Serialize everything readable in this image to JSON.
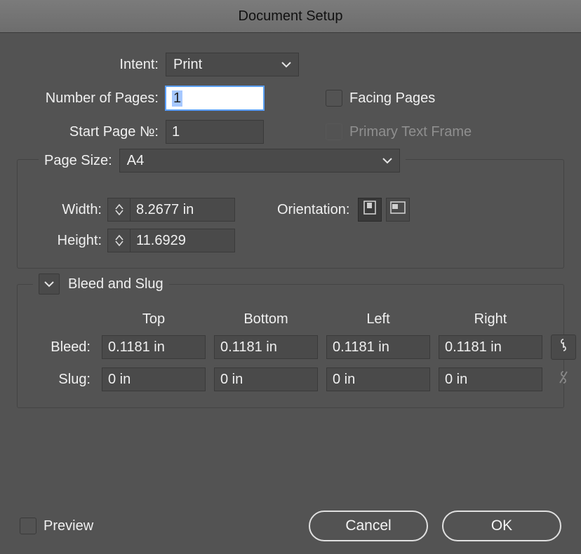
{
  "title": "Document Setup",
  "intent": {
    "label": "Intent:",
    "value": "Print"
  },
  "numPages": {
    "label": "Number of Pages:",
    "value": "1"
  },
  "startPage": {
    "label": "Start Page №:",
    "value": "1"
  },
  "facingPages": {
    "label": "Facing Pages",
    "checked": false
  },
  "primaryTextFrame": {
    "label": "Primary Text Frame",
    "checked": false,
    "disabled": true
  },
  "pageSize": {
    "label": "Page Size:",
    "value": "A4"
  },
  "width": {
    "label": "Width:",
    "value": "8.2677 in"
  },
  "height": {
    "label": "Height:",
    "value": "11.6929"
  },
  "orientation": {
    "label": "Orientation:",
    "value": "portrait"
  },
  "bleedSlug": {
    "title": "Bleed and Slug",
    "headers": {
      "top": "Top",
      "bottom": "Bottom",
      "left": "Left",
      "right": "Right"
    },
    "bleed": {
      "label": "Bleed:",
      "top": "0.1181 in",
      "bottom": "0.1181 in",
      "left": "0.1181 in",
      "right": "0.1181 in",
      "linked": true
    },
    "slug": {
      "label": "Slug:",
      "top": "0 in",
      "bottom": "0 in",
      "left": "0 in",
      "right": "0 in",
      "linked": false
    }
  },
  "preview": {
    "label": "Preview",
    "checked": false
  },
  "buttons": {
    "cancel": "Cancel",
    "ok": "OK"
  }
}
